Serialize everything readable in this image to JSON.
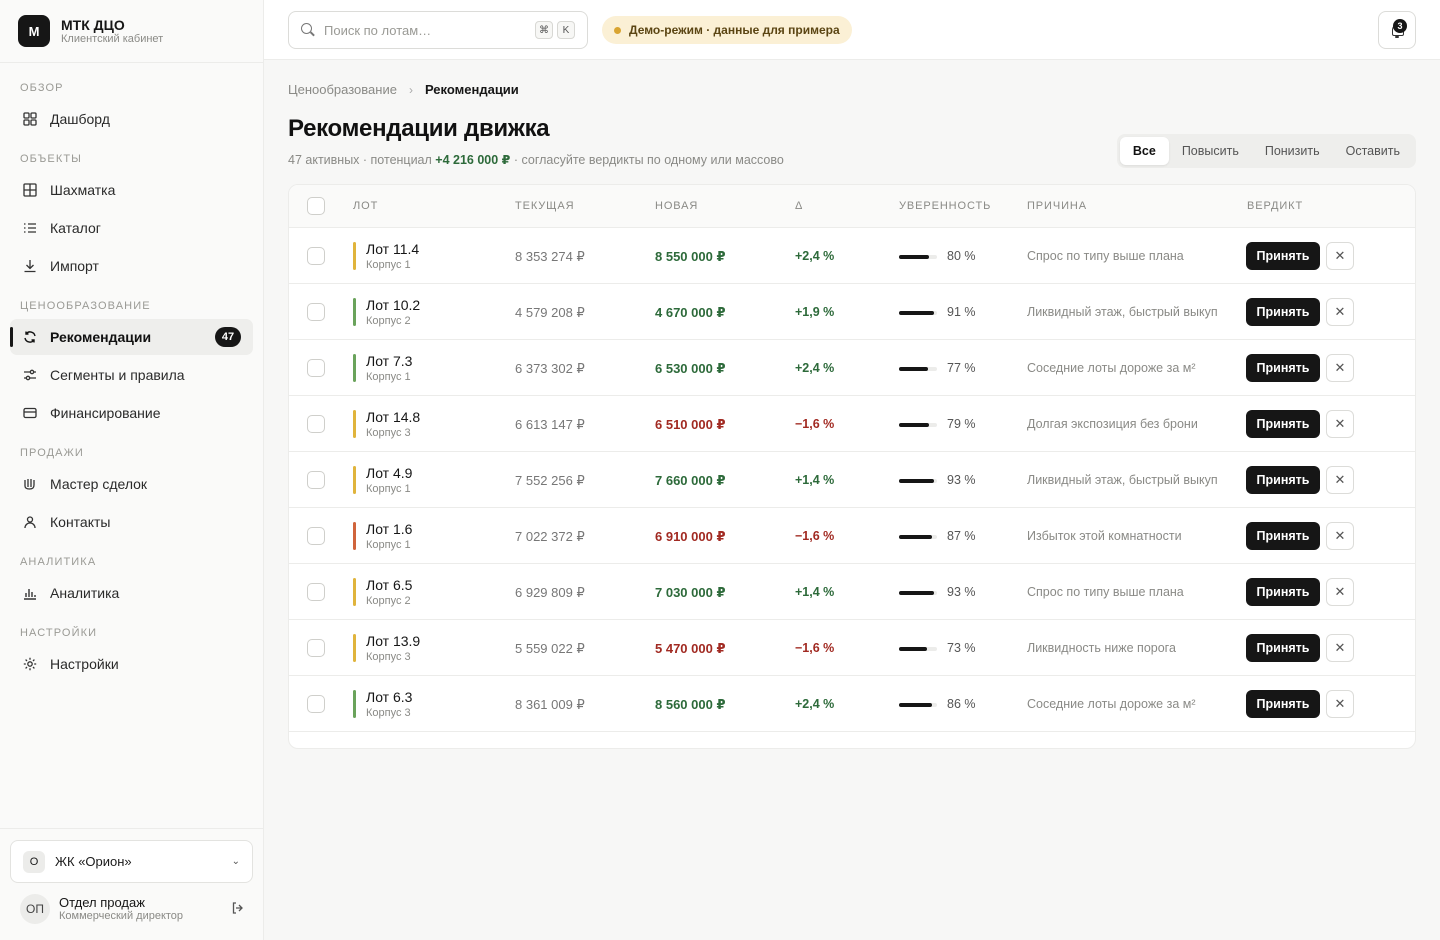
{
  "brand": {
    "logo_letter": "М",
    "title": "МТК ДЦО",
    "subtitle": "Клиентский кабинет"
  },
  "sidebar": {
    "sections": [
      {
        "label": "ОБЗОР",
        "items": [
          {
            "label": "Дашборд",
            "icon": "grid-icon"
          }
        ]
      },
      {
        "label": "ОБЪЕКТЫ",
        "items": [
          {
            "label": "Шахматка",
            "icon": "chessboard-icon"
          },
          {
            "label": "Каталог",
            "icon": "list-icon"
          },
          {
            "label": "Импорт",
            "icon": "download-icon"
          }
        ]
      },
      {
        "label": "ЦЕНООБРАЗОВАНИЕ",
        "items": [
          {
            "label": "Рекомендации",
            "icon": "refresh-icon",
            "badge": "47",
            "active": true
          },
          {
            "label": "Сегменты и правила",
            "icon": "sliders-icon"
          },
          {
            "label": "Финансирование",
            "icon": "card-icon"
          }
        ]
      },
      {
        "label": "ПРОДАЖИ",
        "items": [
          {
            "label": "Мастер сделок",
            "icon": "handshake-icon"
          },
          {
            "label": "Контакты",
            "icon": "user-icon"
          }
        ]
      },
      {
        "label": "АНАЛИТИКА",
        "items": [
          {
            "label": "Аналитика",
            "icon": "bar-chart-icon"
          }
        ]
      },
      {
        "label": "НАСТРОЙКИ",
        "items": [
          {
            "label": "Настройки",
            "icon": "gear-icon"
          }
        ]
      }
    ],
    "project": {
      "badge": "О",
      "name": "ЖК «Орион»"
    },
    "user": {
      "initials": "ОП",
      "name": "Отдел продаж",
      "role": "Коммерческий директор"
    }
  },
  "header": {
    "search_placeholder": "Поиск по лотам…",
    "kbd": [
      "⌘",
      "K"
    ],
    "demo_label": "Демо-режим · данные для примера",
    "notifications_count": "3"
  },
  "breadcrumb": {
    "parent": "Ценообразование",
    "sep": "›",
    "current": "Рекомендации"
  },
  "page": {
    "title": "Рекомендации движка",
    "subtitle_prefix": "47 активных · потенциал ",
    "subtitle_value": "+4 216 000 ₽",
    "subtitle_suffix": " · согласуйте вердикты по одному или массово"
  },
  "filters": [
    "Все",
    "Повысить",
    "Понизить",
    "Оставить"
  ],
  "table": {
    "columns": [
      "ЛОТ",
      "ТЕКУЩАЯ",
      "НОВАЯ",
      "Δ",
      "УВЕРЕННОСТЬ",
      "ПРИЧИНА",
      "ВЕРДИКТ"
    ],
    "accept_label": "Принять",
    "reject_symbol": "✕",
    "colors": {
      "yellow": "#e0b43c",
      "green": "#6aa35b",
      "red": "#d0643c"
    },
    "rows": [
      {
        "lot": "Лот 11.4",
        "building": "Корпус 1",
        "current": "8 353 274 ₽",
        "new": "8 550 000 ₽",
        "delta": "+2,4 %",
        "dir": "pos",
        "confidence": 80,
        "confidence_label": "80 %",
        "reason": "Спрос по типу выше плана",
        "bar": "yellow"
      },
      {
        "lot": "Лот 10.2",
        "building": "Корпус 2",
        "current": "4 579 208 ₽",
        "new": "4 670 000 ₽",
        "delta": "+1,9 %",
        "dir": "pos",
        "confidence": 91,
        "confidence_label": "91 %",
        "reason": "Ликвидный этаж, быстрый выкуп",
        "bar": "green"
      },
      {
        "lot": "Лот 7.3",
        "building": "Корпус 1",
        "current": "6 373 302 ₽",
        "new": "6 530 000 ₽",
        "delta": "+2,4 %",
        "dir": "pos",
        "confidence": 77,
        "confidence_label": "77 %",
        "reason": "Соседние лоты дороже за м²",
        "bar": "green"
      },
      {
        "lot": "Лот 14.8",
        "building": "Корпус 3",
        "current": "6 613 147 ₽",
        "new": "6 510 000 ₽",
        "delta": "−1,6 %",
        "dir": "neg",
        "confidence": 79,
        "confidence_label": "79 %",
        "reason": "Долгая экспозиция без брони",
        "bar": "yellow"
      },
      {
        "lot": "Лот 4.9",
        "building": "Корпус 1",
        "current": "7 552 256 ₽",
        "new": "7 660 000 ₽",
        "delta": "+1,4 %",
        "dir": "pos",
        "confidence": 93,
        "confidence_label": "93 %",
        "reason": "Ликвидный этаж, быстрый выкуп",
        "bar": "yellow"
      },
      {
        "lot": "Лот 1.6",
        "building": "Корпус 1",
        "current": "7 022 372 ₽",
        "new": "6 910 000 ₽",
        "delta": "−1,6 %",
        "dir": "neg",
        "confidence": 87,
        "confidence_label": "87 %",
        "reason": "Избыток этой комнатности",
        "bar": "red"
      },
      {
        "lot": "Лот 6.5",
        "building": "Корпус 2",
        "current": "6 929 809 ₽",
        "new": "7 030 000 ₽",
        "delta": "+1,4 %",
        "dir": "pos",
        "confidence": 93,
        "confidence_label": "93 %",
        "reason": "Спрос по типу выше плана",
        "bar": "yellow"
      },
      {
        "lot": "Лот 13.9",
        "building": "Корпус 3",
        "current": "5 559 022 ₽",
        "new": "5 470 000 ₽",
        "delta": "−1,6 %",
        "dir": "neg",
        "confidence": 73,
        "confidence_label": "73 %",
        "reason": "Ликвидность ниже порога",
        "bar": "yellow"
      },
      {
        "lot": "Лот 6.3",
        "building": "Корпус 3",
        "current": "8 361 009 ₽",
        "new": "8 560 000 ₽",
        "delta": "+2,4 %",
        "dir": "pos",
        "confidence": 86,
        "confidence_label": "86 %",
        "reason": "Соседние лоты дороже за м²",
        "bar": "green"
      }
    ]
  }
}
